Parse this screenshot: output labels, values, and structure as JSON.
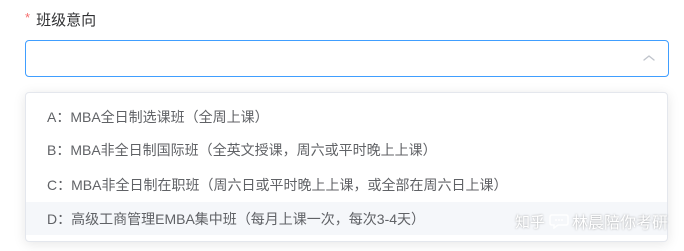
{
  "field": {
    "required_mark": "*",
    "label": "班级意向"
  },
  "select": {
    "value": "",
    "icon": "chevron-up-icon",
    "focused": true
  },
  "options": [
    {
      "label": "A：MBA全日制选课班（全周上课）"
    },
    {
      "label": "B：MBA非全日制国际班（全英文授课，周六或平时晚上上课）"
    },
    {
      "label": "C：MBA非全日制在职班（周六日或平时晚上上课，或全部在周六日上课）"
    },
    {
      "label": "D：高级工商管理EMBA集中班（每月上课一次，每次3-4天）"
    }
  ],
  "hovered_option_index": 3,
  "watermark": {
    "prefix": "知乎",
    "handle": "林晨陪你考研"
  },
  "colors": {
    "accent": "#409eff",
    "required": "#f56c6c",
    "text": "#606266",
    "label": "#303133",
    "hover_bg": "#f5f7fa"
  }
}
